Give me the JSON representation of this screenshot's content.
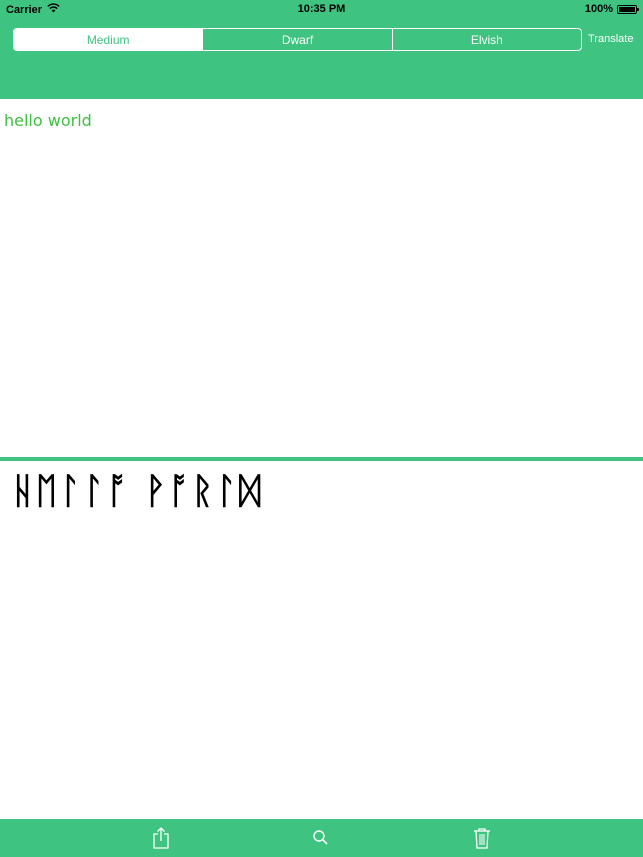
{
  "status_bar": {
    "carrier": "Carrier",
    "time": "10:35 PM",
    "battery": "100%"
  },
  "toolbar": {
    "segments": [
      {
        "label": "Medium",
        "selected": true
      },
      {
        "label": "Dwarf",
        "selected": false
      },
      {
        "label": "Elvish",
        "selected": false
      }
    ],
    "translate_label": "Translate"
  },
  "input": {
    "text": "hello world"
  },
  "output": {
    "runes": "ᚺᛖᛚᛚᚩ ᚹᚩᚱᛚᛞ"
  },
  "bottom_bar": {
    "icons": [
      "share-icon",
      "search-icon",
      "trash-icon"
    ]
  },
  "colors": {
    "accent": "#3fc381",
    "input_text": "#3fbf3f"
  }
}
